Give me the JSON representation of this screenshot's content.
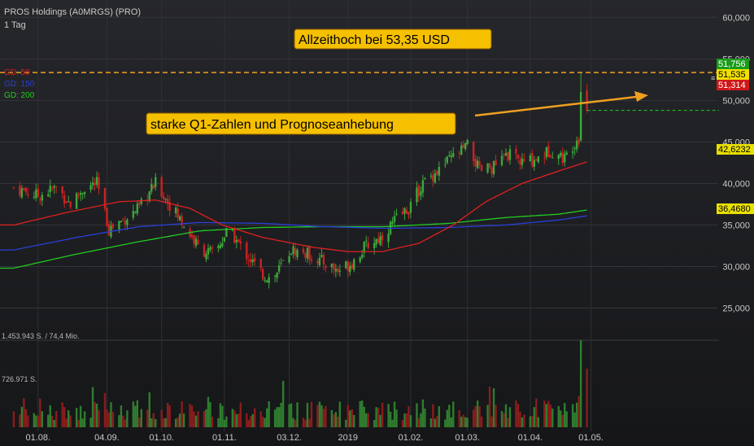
{
  "header": {
    "title": "PROS Holdings (A0MRGS) (PRO)",
    "period": "1 Tag"
  },
  "legend": [
    {
      "label": "GD: 50",
      "color": "#e02020"
    },
    {
      "label": "GD: 150",
      "color": "#2a3fd8"
    },
    {
      "label": "GD: 200",
      "color": "#22cc22"
    }
  ],
  "annotations": {
    "ath": "Allzeithoch bei 53,35 USD",
    "news": "starke Q1-Zahlen und Prognoseanhebung"
  },
  "volume_labels": [
    "1.453.943 S. / 74,4 Mio.",
    "726.971 S."
  ],
  "price_tags": [
    {
      "text": "51,756",
      "value": 51.756,
      "bg": "#1a9c1a",
      "fg": "#ffffff"
    },
    {
      "text": "51,535",
      "value": 51.535,
      "bg": "#f0e000",
      "fg": "#000000"
    },
    {
      "text": "51,314",
      "value": 51.314,
      "bg": "#d01818",
      "fg": "#ffffff"
    },
    {
      "text": "42,6232",
      "value": 42.6232,
      "bg": "#e8e000",
      "fg": "#000000"
    },
    {
      "text": "36,4680",
      "value": 36.468,
      "bg": "#e8e000",
      "fg": "#000000"
    }
  ],
  "colors": {
    "background": "#1b1c1f",
    "up": "#3ca83c",
    "down": "#cc2222",
    "annotation_bg": "#f5c000",
    "annotation_border": "#8a5a00",
    "arrow": "#f0a020",
    "ath_line": "#f0a020",
    "last_line": "#22cc22"
  },
  "chart_data": {
    "type": "candlestick",
    "y_axis": {
      "ticks": [
        25000,
        30000,
        35000,
        40000,
        45000,
        50000,
        55000,
        60000
      ],
      "tick_labels": [
        "25,000",
        "30,000",
        "35,000",
        "40,000",
        "45,000",
        "50,000",
        "55,000",
        "60,000"
      ],
      "range": [
        22.5,
        61.5
      ]
    },
    "x_axis": {
      "ticks": [
        "01.08.",
        "04.09.",
        "01.10.",
        "01.11.",
        "03.12.",
        "2019",
        "01.02.",
        "01.03.",
        "01.04.",
        "01.05."
      ]
    },
    "ath_level": 53.35,
    "last_close": 48.8,
    "close_series": [
      {
        "date": "2018-07-20",
        "close": 39.5
      },
      {
        "date": "2018-08-01",
        "close": 38.5
      },
      {
        "date": "2018-08-10",
        "close": 39.5
      },
      {
        "date": "2018-08-17",
        "close": 37.5
      },
      {
        "date": "2018-08-24",
        "close": 39.5
      },
      {
        "date": "2018-08-30",
        "close": 40.0
      },
      {
        "date": "2018-09-05",
        "close": 34.5
      },
      {
        "date": "2018-09-20",
        "close": 37.0
      },
      {
        "date": "2018-09-28",
        "close": 40.0
      },
      {
        "date": "2018-10-05",
        "close": 37.5
      },
      {
        "date": "2018-10-12",
        "close": 35.0
      },
      {
        "date": "2018-10-20",
        "close": 32.0
      },
      {
        "date": "2018-10-27",
        "close": 31.5
      },
      {
        "date": "2018-11-03",
        "close": 34.5
      },
      {
        "date": "2018-11-10",
        "close": 32.0
      },
      {
        "date": "2018-11-20",
        "close": 29.0
      },
      {
        "date": "2018-11-25",
        "close": 28.5
      },
      {
        "date": "2018-12-04",
        "close": 32.0
      },
      {
        "date": "2018-12-12",
        "close": 31.5
      },
      {
        "date": "2018-12-20",
        "close": 30.5
      },
      {
        "date": "2018-12-27",
        "close": 29.5
      },
      {
        "date": "2019-01-03",
        "close": 30.5
      },
      {
        "date": "2019-01-10",
        "close": 32.5
      },
      {
        "date": "2019-01-17",
        "close": 33.5
      },
      {
        "date": "2019-01-24",
        "close": 35.5
      },
      {
        "date": "2019-01-31",
        "close": 37.0
      },
      {
        "date": "2019-02-07",
        "close": 40.0
      },
      {
        "date": "2019-02-14",
        "close": 41.5
      },
      {
        "date": "2019-02-21",
        "close": 43.0
      },
      {
        "date": "2019-03-01",
        "close": 44.5
      },
      {
        "date": "2019-03-07",
        "close": 41.5
      },
      {
        "date": "2019-03-14",
        "close": 42.0
      },
      {
        "date": "2019-03-21",
        "close": 43.5
      },
      {
        "date": "2019-03-28",
        "close": 42.5
      },
      {
        "date": "2019-04-04",
        "close": 43.0
      },
      {
        "date": "2019-04-11",
        "close": 44.0
      },
      {
        "date": "2019-04-18",
        "close": 43.0
      },
      {
        "date": "2019-04-23",
        "close": 45.0
      },
      {
        "date": "2019-04-25",
        "close": 45.5
      },
      {
        "date": "2019-04-26",
        "close": 51.0
      },
      {
        "date": "2019-04-29",
        "close": 48.8
      }
    ],
    "gd50": [
      {
        "date": "2018-07-20",
        "value": 35.0
      },
      {
        "date": "2018-08-15",
        "value": 36.5
      },
      {
        "date": "2018-09-10",
        "value": 37.8
      },
      {
        "date": "2018-09-28",
        "value": 38.0
      },
      {
        "date": "2018-10-15",
        "value": 37.0
      },
      {
        "date": "2018-10-31",
        "value": 35.0
      },
      {
        "date": "2018-11-20",
        "value": 33.5
      },
      {
        "date": "2018-12-15",
        "value": 32.3
      },
      {
        "date": "2019-01-01",
        "value": 31.8
      },
      {
        "date": "2019-01-18",
        "value": 31.8
      },
      {
        "date": "2019-02-05",
        "value": 32.8
      },
      {
        "date": "2019-02-22",
        "value": 35.0
      },
      {
        "date": "2019-03-10",
        "value": 37.8
      },
      {
        "date": "2019-03-28",
        "value": 40.0
      },
      {
        "date": "2019-04-15",
        "value": 41.5
      },
      {
        "date": "2019-04-29",
        "value": 42.6
      }
    ],
    "gd150": [
      {
        "date": "2018-07-20",
        "value": 32.0
      },
      {
        "date": "2018-08-20",
        "value": 33.5
      },
      {
        "date": "2018-09-20",
        "value": 34.8
      },
      {
        "date": "2018-10-20",
        "value": 35.3
      },
      {
        "date": "2018-11-20",
        "value": 35.2
      },
      {
        "date": "2018-12-20",
        "value": 34.8
      },
      {
        "date": "2019-01-20",
        "value": 34.6
      },
      {
        "date": "2019-02-20",
        "value": 34.7
      },
      {
        "date": "2019-03-20",
        "value": 35.0
      },
      {
        "date": "2019-04-15",
        "value": 35.6
      },
      {
        "date": "2019-04-29",
        "value": 36.1
      }
    ],
    "gd200": [
      {
        "date": "2018-07-20",
        "value": 29.8
      },
      {
        "date": "2018-08-20",
        "value": 31.5
      },
      {
        "date": "2018-09-20",
        "value": 33.0
      },
      {
        "date": "2018-10-20",
        "value": 34.3
      },
      {
        "date": "2018-11-20",
        "value": 34.7
      },
      {
        "date": "2018-12-20",
        "value": 34.8
      },
      {
        "date": "2019-01-20",
        "value": 34.8
      },
      {
        "date": "2019-02-20",
        "value": 35.2
      },
      {
        "date": "2019-03-20",
        "value": 35.9
      },
      {
        "date": "2019-04-15",
        "value": 36.3
      },
      {
        "date": "2019-04-29",
        "value": 36.8
      }
    ],
    "volume_peak": 1453943
  }
}
